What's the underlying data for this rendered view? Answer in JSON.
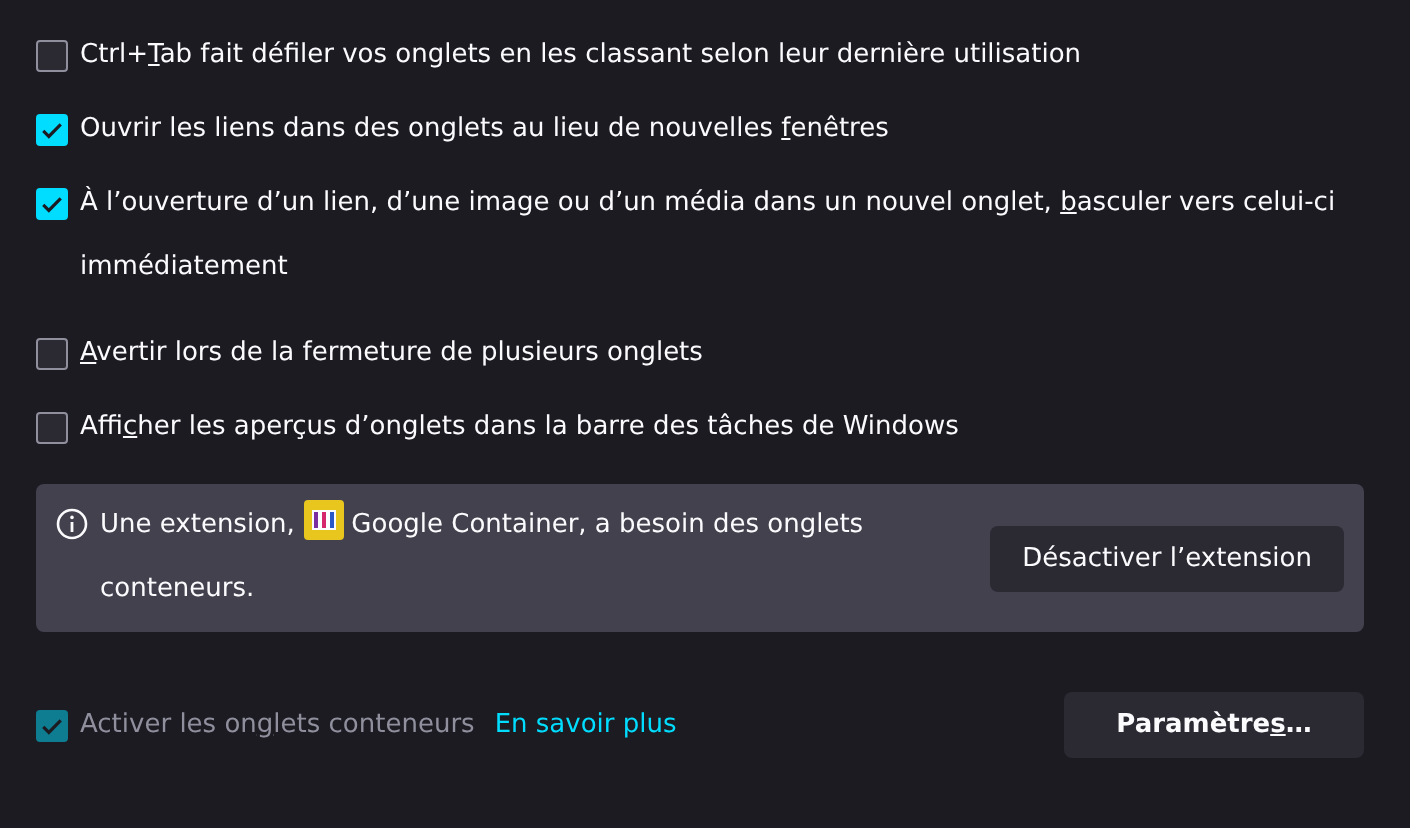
{
  "options": [
    {
      "pre": "Ctrl+",
      "key": "T",
      "post": "ab fait défiler vos onglets en les classant selon leur dernière utilisation",
      "checked": false
    },
    {
      "pre": "Ouvrir les liens dans des onglets au lieu de nouvelles ",
      "key": "f",
      "post": "enêtres",
      "checked": true
    },
    {
      "pre": "À l’ouverture d’un lien, d’une image ou d’un média dans un nouvel onglet, ",
      "key": "b",
      "post": "asculer vers celui-ci immédiatement",
      "checked": true
    },
    {
      "key": "A",
      "post": "vertir lors de la fermeture de plusieurs onglets",
      "checked": false
    },
    {
      "pre": "Affi",
      "key": "c",
      "post": "her les aperçus d’onglets dans la barre des tâches de Windows",
      "checked": false
    }
  ],
  "notice": {
    "before": "Une extension,",
    "extension": "Google Container",
    "after": ", a besoin des onglets conteneurs.",
    "button": "Désactiver l’extension"
  },
  "containers": {
    "pre": "Activer les on",
    "key": "g",
    "post": "lets conteneurs",
    "checked": true,
    "disabled": true,
    "link": "En savoir plus",
    "settings": {
      "pre": "Paramètre",
      "key": "s",
      "post": "…"
    }
  }
}
